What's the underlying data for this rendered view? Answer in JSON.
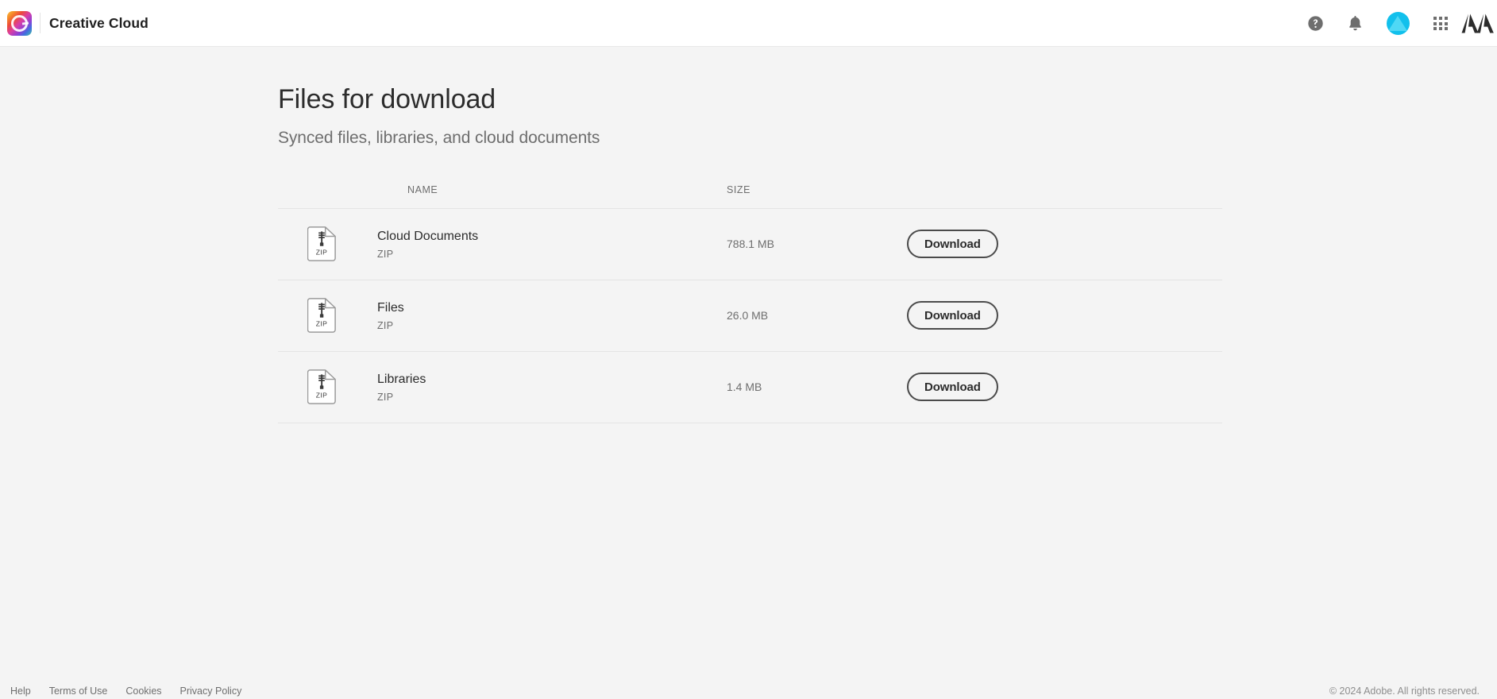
{
  "appbar": {
    "logo_icon": "creative-cloud-logo-icon",
    "title": "Creative Cloud",
    "icons": [
      {
        "name": "help-icon",
        "label": "Help"
      },
      {
        "name": "notifications-bell-icon",
        "label": "Notifications"
      },
      {
        "name": "user-avatar",
        "label": "Account"
      },
      {
        "name": "app-switcher-grid-icon",
        "label": "Apps"
      },
      {
        "name": "adobe-logo-icon",
        "label": "Adobe"
      }
    ]
  },
  "page": {
    "title": "Files for download",
    "subtitle": "Synced files, libraries, and cloud documents"
  },
  "table": {
    "columns": {
      "name": "NAME",
      "size": "SIZE"
    },
    "rows": [
      {
        "icon": "zip-file-icon",
        "icon_label": "ZIP",
        "name": "Cloud Documents",
        "type": "ZIP",
        "size": "788.1 MB",
        "action": "Download"
      },
      {
        "icon": "zip-file-icon",
        "icon_label": "ZIP",
        "name": "Files",
        "type": "ZIP",
        "size": "26.0 MB",
        "action": "Download"
      },
      {
        "icon": "zip-file-icon",
        "icon_label": "ZIP",
        "name": "Libraries",
        "type": "ZIP",
        "size": "1.4 MB",
        "action": "Download"
      }
    ]
  },
  "footer": {
    "links": [
      "Help",
      "Terms of Use",
      "Cookies",
      "Privacy Policy"
    ],
    "copyright": "© 2024 Adobe. All rights reserved."
  },
  "colors": {
    "page_background": "#f4f4f4",
    "appbar_background": "#ffffff",
    "text_primary": "#2c2c2c",
    "text_secondary": "#6e6e6e",
    "divider": "#e4e4e4",
    "avatar": "#12c0ec",
    "button_border": "#4b4b4b"
  }
}
